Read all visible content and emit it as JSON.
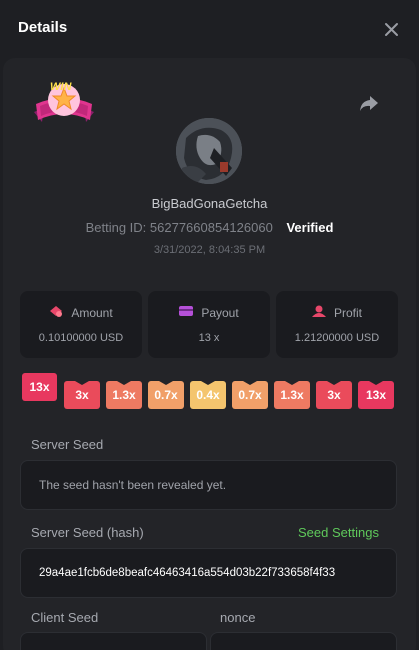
{
  "header": {
    "title": "Details"
  },
  "icons": {
    "close": "close-icon",
    "share": "share-arrow-icon",
    "win_badge": "win-badge-icon"
  },
  "user": {
    "name": "BigBadGonaGetcha",
    "betting_id_label": "Betting ID:",
    "betting_id": "56277660854126060",
    "verified": "Verified",
    "timestamp": "3/31/2022, 8:04:35 PM"
  },
  "badge": {
    "text": "WIN"
  },
  "stats": [
    {
      "label": "Amount",
      "value": "0.10100000 USD",
      "icon": "coins-icon",
      "color": "#e8476a"
    },
    {
      "label": "Payout",
      "value": "13 x",
      "icon": "wallet-icon",
      "color": "#b550d8"
    },
    {
      "label": "Profit",
      "value": "1.21200000 USD",
      "icon": "profit-icon",
      "color": "#e8476a"
    }
  ],
  "multipliers": [
    {
      "label": "13x",
      "color": "#e8385f",
      "selected": true
    },
    {
      "label": "3x",
      "color": "#ea4b5b"
    },
    {
      "label": "1.3x",
      "color": "#ee7a62"
    },
    {
      "label": "0.7x",
      "color": "#f1a069"
    },
    {
      "label": "0.4x",
      "color": "#f4c56e"
    },
    {
      "label": "0.7x",
      "color": "#f1a069"
    },
    {
      "label": "1.3x",
      "color": "#ee7a62"
    },
    {
      "label": "3x",
      "color": "#ea4b5b"
    },
    {
      "label": "13x",
      "color": "#e8385f"
    }
  ],
  "server_seed": {
    "label": "Server Seed",
    "value": "The seed hasn't been revealed yet."
  },
  "server_seed_hash": {
    "label": "Server Seed (hash)",
    "settings_link": "Seed Settings",
    "value": "29a4ae1fcb6de8beafc46463416a554d03b22f733658f4f33"
  },
  "client_seed": {
    "label": "Client Seed"
  },
  "nonce": {
    "label": "nonce"
  }
}
